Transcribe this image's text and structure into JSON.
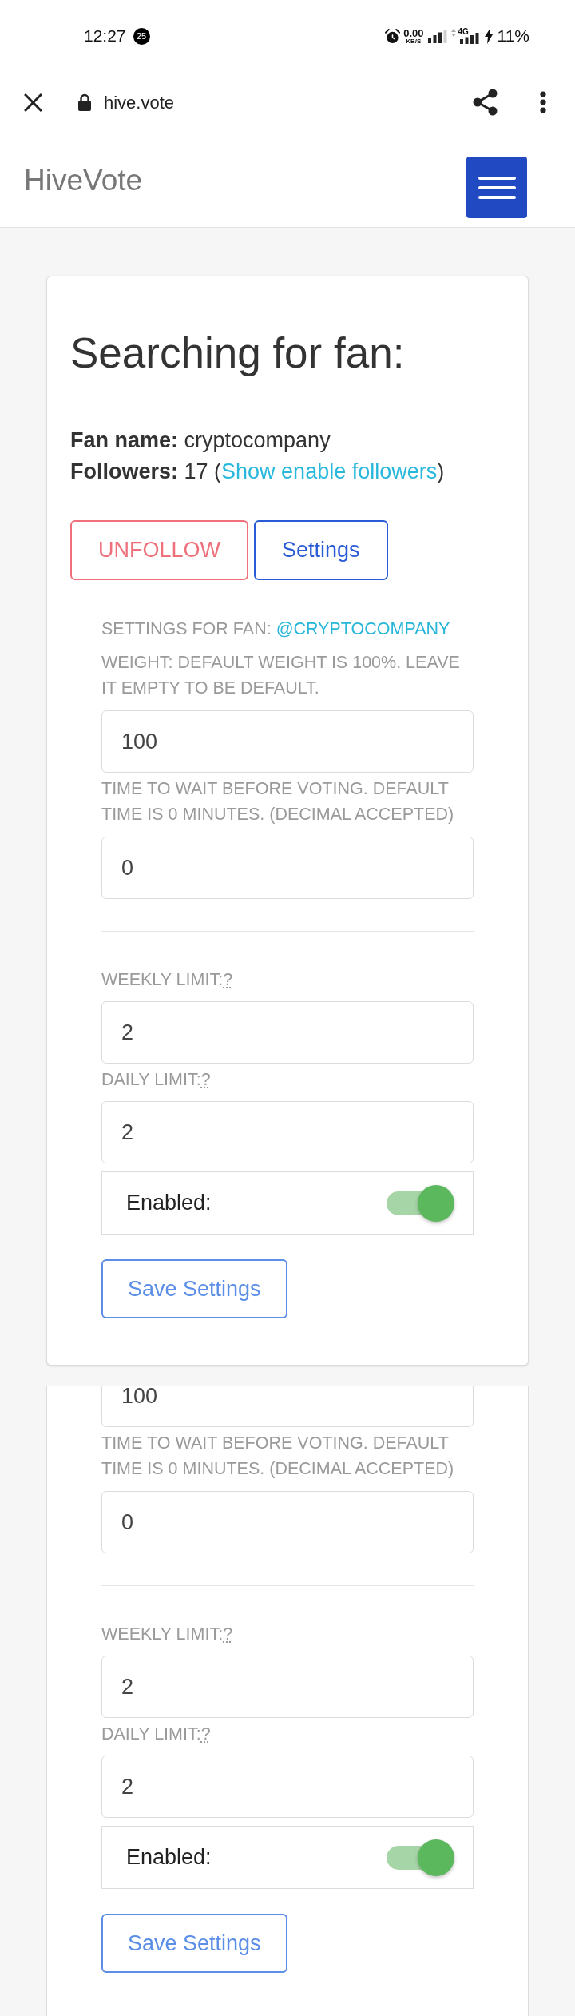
{
  "status_bar": {
    "time": "12:27",
    "badge": "25",
    "speed": "0.00",
    "speed_unit": "KB/S",
    "network": "4G",
    "battery": "11%"
  },
  "browser_bar": {
    "url": "hive.vote"
  },
  "navbar": {
    "brand": "HiveVote"
  },
  "fan_card": {
    "title": "Searching for fan:",
    "details": [
      {
        "label": "Fan name:",
        "value": "cryptocompany"
      },
      {
        "label": "Followers:",
        "value": "17 (",
        "link": "Show enable followers",
        "value_after": ")"
      }
    ],
    "actions": [
      {
        "label": "UNFOLLOW",
        "kind": "danger"
      },
      {
        "label": "Settings",
        "kind": "primary"
      }
    ],
    "settings": {
      "heading": "SETTINGS FOR FAN:",
      "handle": "@CRYPTOCOMPANY",
      "vote_fields": [
        {
          "label": "WEIGHT: DEFAULT WEIGHT IS 100%. LEAVE IT EMPTY TO BE DEFAULT.",
          "value": "100"
        },
        {
          "label": "TIME TO WAIT BEFORE VOTING. DEFAULT TIME IS 0 MINUTES. (DECIMAL ACCEPTED)",
          "value": "0"
        }
      ],
      "limit_fields": [
        {
          "label": "WEEKLY LIMIT:",
          "hint": "?",
          "value": "2"
        },
        {
          "label": "DAILY LIMIT:",
          "hint": "?",
          "value": "2"
        }
      ],
      "enabled": {
        "label": "Enabled:",
        "on": true
      },
      "save_button": "Save Settings"
    }
  },
  "next_panel": {
    "vote_fields": [
      {
        "value": "100"
      },
      {
        "label": "TIME TO WAIT BEFORE VOTING. DEFAULT TIME IS 0 MINUTES. (DECIMAL ACCEPTED)",
        "value": "0"
      }
    ],
    "limit_fields": [
      {
        "label": "WEEKLY LIMIT:",
        "hint": "?",
        "value": "2"
      },
      {
        "label": "DAILY LIMIT:",
        "hint": "?",
        "value": "2"
      }
    ],
    "enabled": {
      "label": "Enabled:",
      "on": true
    },
    "save_button": "Save Settings"
  }
}
